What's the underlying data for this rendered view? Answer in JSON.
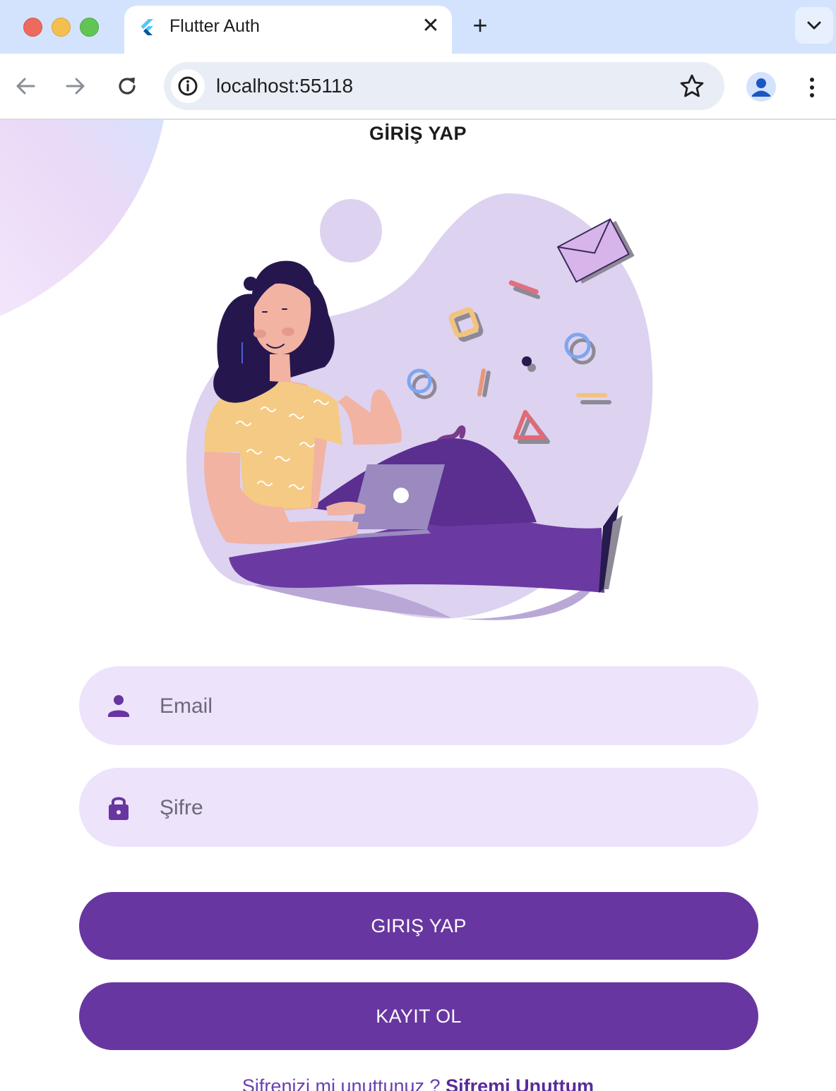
{
  "browser": {
    "tab_title": "Flutter Auth",
    "tab_close_glyph": "✕",
    "new_tab_glyph": "+",
    "url": "localhost:55118"
  },
  "icons": {
    "favicon": "flutter-logo-icon",
    "back": "arrow-left-icon",
    "forward": "arrow-right-icon",
    "reload": "reload-icon",
    "site_info": "info-icon",
    "bookmark": "star-icon",
    "profile": "person-icon",
    "menu": "more-vert-icon",
    "email_field": "person-icon",
    "password_field": "lock-icon"
  },
  "page": {
    "title": "GİRİŞ YAP",
    "email_placeholder": "Email",
    "password_placeholder": "Şifre",
    "login_button": "GIRIŞ YAP",
    "register_button": "KAYIT OL",
    "forgot_prompt": "Şifrenizi mi unuttunuz ? ",
    "forgot_link": "Şifremi Unuttum"
  },
  "colors": {
    "primary": "#6836a0",
    "field_bg": "#ede3fb",
    "tabbar_bg": "#d3e3fd"
  }
}
